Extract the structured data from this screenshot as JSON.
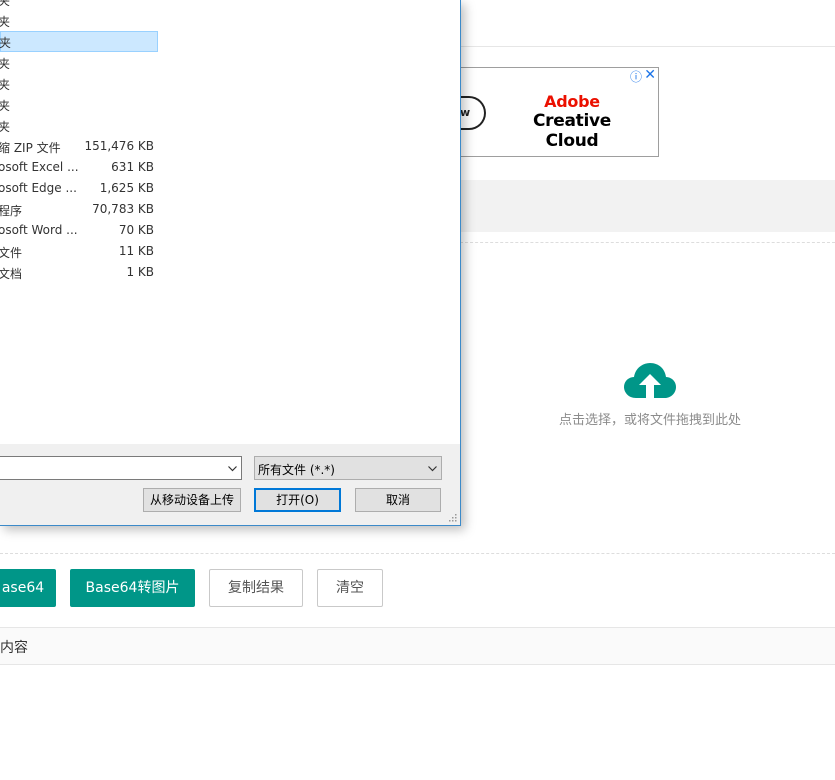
{
  "file_dialog": {
    "rows": [
      {
        "type": "夹",
        "size": ""
      },
      {
        "type": "夹",
        "size": ""
      },
      {
        "type": "夹",
        "size": "",
        "selected": true
      },
      {
        "type": "夹",
        "size": ""
      },
      {
        "type": "夹",
        "size": ""
      },
      {
        "type": "夹",
        "size": ""
      },
      {
        "type": "夹",
        "size": ""
      },
      {
        "type": "缩 ZIP 文件",
        "size": "151,476 KB"
      },
      {
        "type": "osoft Excel ...",
        "size": "631 KB"
      },
      {
        "type": "osoft Edge ...",
        "size": "1,625 KB"
      },
      {
        "type": "程序",
        "size": "70,783 KB"
      },
      {
        "type": "osoft Word ...",
        "size": "70 KB"
      },
      {
        "type": "文件",
        "size": "11 KB"
      },
      {
        "type": "文档",
        "size": "1 KB"
      }
    ],
    "filename_value": "",
    "filter_value": "所有文件 (*.*)",
    "upload_from_device_label": "从移动设备上传",
    "open_label": "打开(O)",
    "cancel_label": "取消"
  },
  "ad": {
    "pill_text": "w",
    "brand_line1": "Adobe",
    "brand_line2": "Creative Cloud",
    "info_icon": "info-icon",
    "close_icon": "close-icon"
  },
  "upload": {
    "icon": "cloud-upload-icon",
    "hint": "点击选择，或将文件拖拽到此处"
  },
  "actions": {
    "to_base64_label": "ase64",
    "base64_to_image_label": "Base64转图片",
    "copy_result_label": "复制结果",
    "clear_label": "清空"
  },
  "result_section": {
    "title": "内容"
  },
  "colors": {
    "accent": "#009688",
    "dialog_border": "#3c8ac9",
    "selection": "#cce8ff",
    "adobe_red": "#eb1000"
  }
}
